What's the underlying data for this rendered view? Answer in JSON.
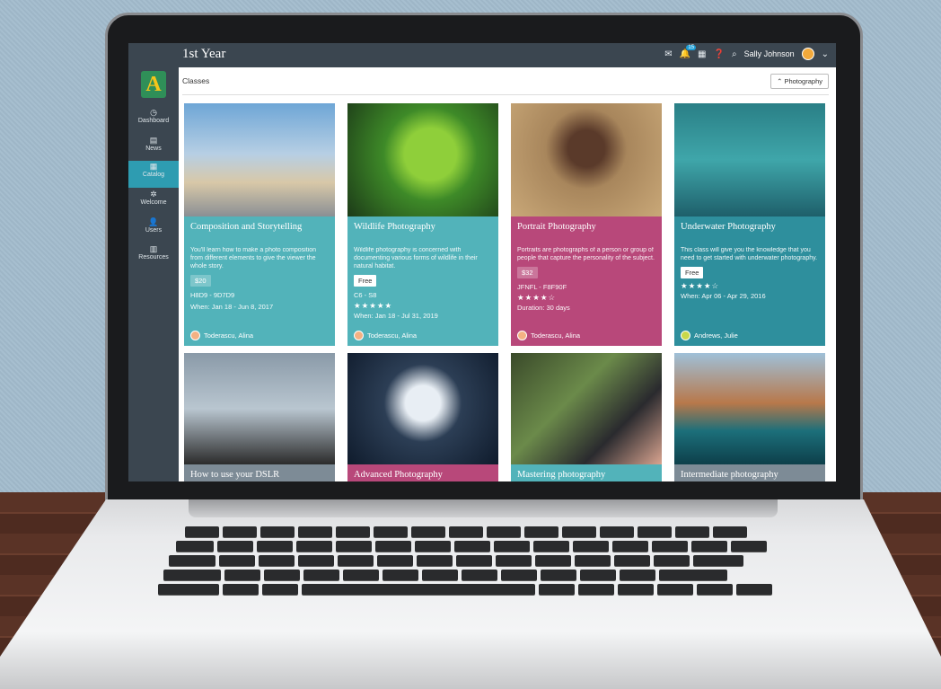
{
  "header": {
    "title": "1st Year",
    "user_name": "Sally Johnson",
    "notification_count": "15"
  },
  "sidebar": {
    "logo_letter": "A",
    "items": [
      {
        "label": "Dashboard",
        "icon": "dashboard-icon"
      },
      {
        "label": "News",
        "icon": "news-icon"
      },
      {
        "label": "Catalog",
        "icon": "catalog-icon",
        "active": true
      },
      {
        "label": "Welcome",
        "icon": "welcome-icon"
      },
      {
        "label": "Users",
        "icon": "users-icon"
      },
      {
        "label": "Resources",
        "icon": "resources-icon"
      }
    ]
  },
  "main": {
    "tab_label": "Classes",
    "filter_label": "Photography"
  },
  "cards": [
    {
      "title": "Composition and Storytelling",
      "desc": "You'll learn how to make a photo composition from different elements to give the viewer the whole story.",
      "price": "$20",
      "code": "H8D9 - 9D7D9",
      "stars": "",
      "when": "When: Jan 18 - Jun 8, 2017",
      "author": "Toderascu, Alina",
      "color": "#52b3ba"
    },
    {
      "title": "Wildlife Photography",
      "desc": "Wildlife photography is concerned with documenting various forms of wildlife in their natural habitat.",
      "price": "Free",
      "code": "C6 - S8",
      "stars": "★★★★★",
      "when": "When: Jan 18 - Jul 31, 2019",
      "author": "Toderascu, Alina",
      "color": "#52b3ba"
    },
    {
      "title": "Portrait Photography",
      "desc": "Portraits are photographs of a person or group of people that capture the personality of the subject.",
      "price": "$32",
      "code": "JFNFL - F8F90F",
      "stars": "★★★★☆",
      "when": "Duration: 30 days",
      "author": "Toderascu, Alina",
      "color": "#b8487a"
    },
    {
      "title": "Underwater Photography",
      "desc": "This class will give you the knowledge that you need to get started with underwater photography.",
      "price": "Free",
      "code": "",
      "stars": "★★★★☆",
      "when": "When: Apr 06 - Apr 29, 2016",
      "author": "Andrews, Julie",
      "color": "#2e8f9d"
    },
    {
      "title": "How to use your DSLR",
      "color": "#7d8b96"
    },
    {
      "title": "Advanced Photography",
      "color": "#b8487a"
    },
    {
      "title": "Mastering photography",
      "color": "#52b3ba"
    },
    {
      "title": "Intermediate photography",
      "color": "#7d8b96"
    }
  ],
  "colors": {
    "topbar": "#3b4650",
    "accent": "#2e9cb1"
  }
}
